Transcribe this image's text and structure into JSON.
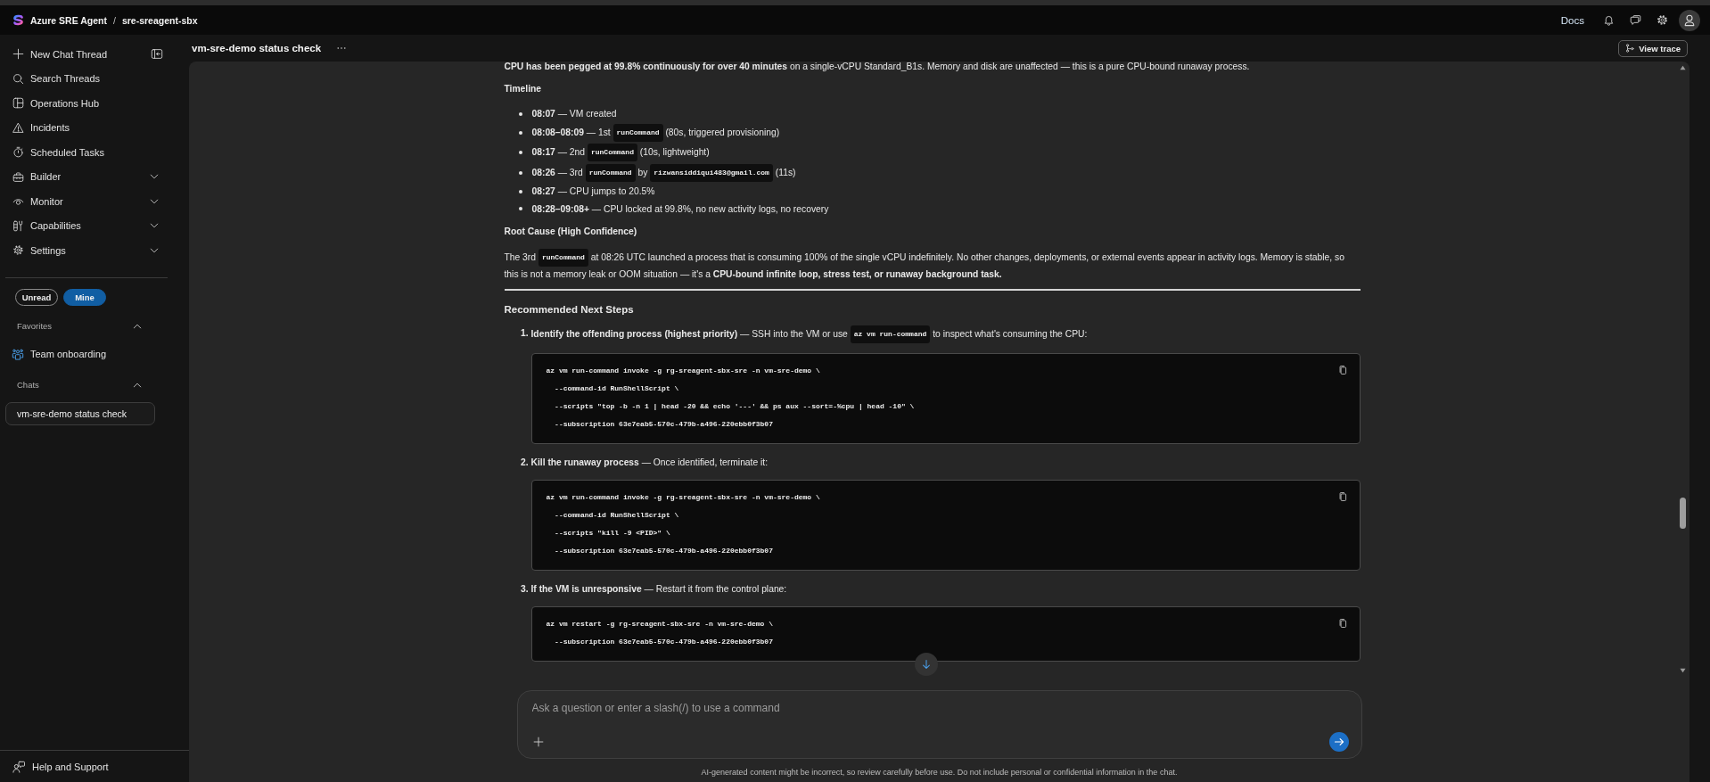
{
  "top_bar": {
    "product": "Azure SRE Agent",
    "separator": "/",
    "resource": "sre-sreagent-sbx",
    "docs": "Docs"
  },
  "sidebar": {
    "nav": [
      {
        "label": "New Chat Thread",
        "kind": "new_thread"
      },
      {
        "label": "Search Threads",
        "kind": "link"
      },
      {
        "label": "Operations Hub",
        "kind": "link"
      },
      {
        "label": "Incidents",
        "kind": "link"
      },
      {
        "label": "Scheduled Tasks",
        "kind": "link"
      },
      {
        "label": "Builder",
        "kind": "group",
        "expanded": false
      },
      {
        "label": "Monitor",
        "kind": "group",
        "expanded": false
      },
      {
        "label": "Capabilities",
        "kind": "group",
        "expanded": false
      },
      {
        "label": "Settings",
        "kind": "group",
        "expanded": false
      }
    ],
    "filters": [
      {
        "label": "Unread",
        "selected": false
      },
      {
        "label": "Mine",
        "selected": true
      }
    ],
    "sections": [
      {
        "title": "Favorites",
        "expanded": true,
        "items": [
          {
            "label": "Team onboarding",
            "kind": "team"
          }
        ]
      },
      {
        "title": "Chats",
        "expanded": true,
        "items": [
          {
            "label": "vm-sre-demo status check",
            "kind": "chat",
            "selected": true
          }
        ]
      }
    ],
    "help": "Help and Support"
  },
  "thread": {
    "title": "vm-sre-demo status check",
    "view_trace": "View trace"
  },
  "message": [
    {
      "kind": "paragraph",
      "parts": [
        {
          "kind": "text",
          "text": "**CPU has been pegged at 99.8% continuously for over 40 minutes** on a single-vCPU Standard_B1s. Memory and disk are unaffected — this is a pure CPU-bound runaway process."
        }
      ]
    },
    {
      "kind": "heading",
      "text": "Timeline"
    },
    {
      "kind": "bullets",
      "items": [
        {
          "parts": [
            {
              "kind": "text",
              "text": "**08:07** — VM created"
            }
          ]
        },
        {
          "parts": [
            {
              "kind": "text",
              "text": "**08:08–08:09** — 1st"
            },
            {
              "kind": "code",
              "text": "runCommand"
            },
            {
              "kind": "text",
              "text": "(80s, triggered provisioning)"
            }
          ]
        },
        {
          "parts": [
            {
              "kind": "text",
              "text": "**08:17** — 2nd"
            },
            {
              "kind": "code",
              "text": "runCommand"
            },
            {
              "kind": "text",
              "text": "(10s, lightweight)"
            }
          ]
        },
        {
          "parts": [
            {
              "kind": "text",
              "text": "**08:26** — 3rd"
            },
            {
              "kind": "code",
              "text": "runCommand"
            },
            {
              "kind": "text",
              "text": "by"
            },
            {
              "kind": "code",
              "text": "rizwansiddiqui483@gmail.com"
            },
            {
              "kind": "text",
              "text": "(11s)"
            }
          ]
        },
        {
          "parts": [
            {
              "kind": "text",
              "text": "**08:27** — CPU jumps to 20.5%"
            }
          ]
        },
        {
          "parts": [
            {
              "kind": "text",
              "text": "**08:28–09:08+** — CPU locked at 99.8%, no new activity logs, no recovery"
            }
          ]
        }
      ]
    },
    {
      "kind": "heading",
      "text": "Root Cause (High Confidence)"
    },
    {
      "kind": "paragraph",
      "parts": [
        {
          "kind": "text",
          "text": "The 3rd"
        },
        {
          "kind": "code",
          "text": "runCommand"
        },
        {
          "kind": "text",
          "text": "at 08:26 UTC launched a process that is consuming 100% of the single vCPU indefinitely. No other changes, deployments, or external events appear in activity logs. Memory is stable, so this is not a memory leak or OOM situation — it's a **CPU-bound infinite loop, stress test, or runaway background task.**"
        }
      ]
    },
    {
      "kind": "rule"
    },
    {
      "kind": "section_heading",
      "text": "Recommended Next Steps"
    },
    {
      "kind": "steps",
      "items": [
        {
          "number": "1.",
          "parts": [
            {
              "kind": "text",
              "text": "**Identify the offending process (highest priority)** — SSH into the VM or use"
            },
            {
              "kind": "code",
              "text": "az vm run-command"
            },
            {
              "kind": "text",
              "text": "to inspect what's consuming the CPU:"
            }
          ],
          "code": [
            "az vm run-command invoke -g rg-sreagent-sbx-sre -n vm-sre-demo \\",
            "  --command-id RunShellScript \\",
            "  --scripts \"top -b -n 1 | head -20 && echo '---' && ps aux --sort=-%cpu | head -10\" \\",
            "  --subscription 63e7eab5-570c-479b-a496-220ebb0f3b07"
          ]
        },
        {
          "number": "2.",
          "parts": [
            {
              "kind": "text",
              "text": "**Kill the runaway process** — Once identified, terminate it:"
            }
          ],
          "code": [
            "az vm run-command invoke -g rg-sreagent-sbx-sre -n vm-sre-demo \\",
            "  --command-id RunShellScript \\",
            "  --scripts \"kill -9 <PID>\" \\",
            "  --subscription 63e7eab5-570c-479b-a496-220ebb0f3b07"
          ]
        },
        {
          "number": "3.",
          "parts": [
            {
              "kind": "text",
              "text": "**If the VM is unresponsive** — Restart it from the control plane:"
            }
          ],
          "code": [
            "az vm restart -g rg-sreagent-sbx-sre -n vm-sre-demo \\",
            "  --subscription 63e7eab5-570c-479b-a496-220ebb0f3b07"
          ]
        }
      ]
    }
  ],
  "composer": {
    "placeholder": "Ask a question or enter a slash(/) to use a command"
  },
  "disclaimer": "AI-generated content might be incorrect, so review carefully before use. Do not include personal or confidential information in the chat."
}
